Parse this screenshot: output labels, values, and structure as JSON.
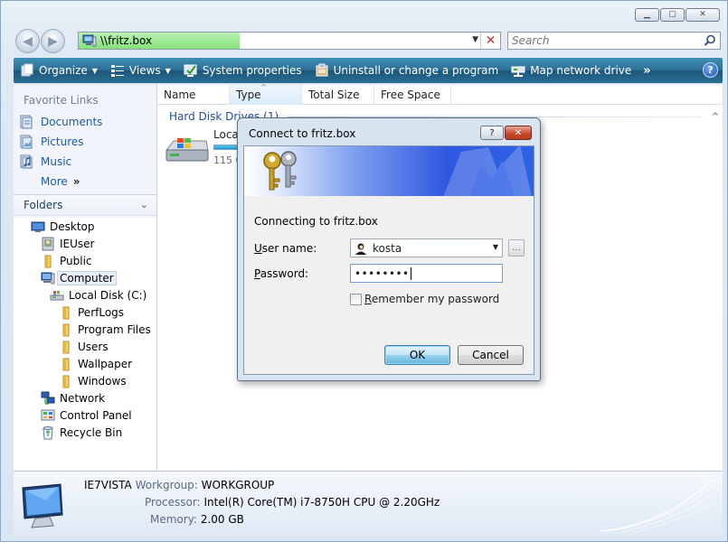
{
  "window": {
    "caption_buttons": [
      "minimize",
      "maximize",
      "close"
    ]
  },
  "address": {
    "path": "\\\\fritz.box"
  },
  "search": {
    "placeholder": "Search"
  },
  "toolbar": {
    "organize": "Organize",
    "views": "Views",
    "system_properties": "System properties",
    "uninstall": "Uninstall or change a program",
    "map_drive": "Map network drive",
    "more": "»",
    "help": "?"
  },
  "sidebar": {
    "favorite_links_title": "Favorite Links",
    "favorites": [
      {
        "label": "Documents",
        "icon": "documents-icon"
      },
      {
        "label": "Pictures",
        "icon": "pictures-icon"
      },
      {
        "label": "Music",
        "icon": "music-icon"
      }
    ],
    "more": "More",
    "more_chevron": "»",
    "folders_title": "Folders",
    "tree": [
      {
        "label": "Desktop",
        "icon": "desktop-icon"
      },
      {
        "label": "IEUser",
        "icon": "user-folder-icon"
      },
      {
        "label": "Public",
        "icon": "folder-icon"
      },
      {
        "label": "Computer",
        "icon": "computer-icon"
      },
      {
        "label": "Local Disk (C:)",
        "icon": "drive-icon"
      },
      {
        "label": "PerfLogs",
        "icon": "folder-icon"
      },
      {
        "label": "Program Files",
        "icon": "folder-icon"
      },
      {
        "label": "Users",
        "icon": "folder-icon"
      },
      {
        "label": "Wallpaper",
        "icon": "folder-icon"
      },
      {
        "label": "Windows",
        "icon": "folder-icon"
      },
      {
        "label": "Network",
        "icon": "network-icon"
      },
      {
        "label": "Control Panel",
        "icon": "control-panel-icon"
      },
      {
        "label": "Recycle Bin",
        "icon": "recycle-bin-icon"
      }
    ]
  },
  "content": {
    "columns": [
      "Name",
      "Type",
      "Total Size",
      "Free Space"
    ],
    "sorted_column": "Type",
    "group_header": "Hard Disk Drives (1)",
    "drive": {
      "name": "Local",
      "size_text": "115 G",
      "fill_fraction": 0.25
    }
  },
  "details": {
    "computer_name": "IE7VISTA",
    "workgroup_label": "Workgroup:",
    "workgroup": "WORKGROUP",
    "processor_label": "Processor:",
    "processor": "Intel(R) Core(TM) i7-8750H CPU @ 2.20GHz",
    "memory_label": "Memory:",
    "memory": "2.00 GB"
  },
  "dialog": {
    "title": "Connect to fritz.box",
    "help_button": "?",
    "close_button": "✕",
    "connecting_text": "Connecting to fritz.box",
    "username_label_pre": "",
    "username_label_key": "U",
    "username_label_post": "ser name:",
    "username_value": "kosta",
    "browse_label": "...",
    "password_label_pre": "",
    "password_label_key": "P",
    "password_label_post": "assword:",
    "password_value": "••••••••",
    "remember_label_pre": "",
    "remember_label_key": "R",
    "remember_label_post": "emember my password",
    "remember_checked": false,
    "ok": "OK",
    "cancel": "Cancel"
  },
  "colors": {
    "command_bar": "#2d6f96",
    "link_blue": "#1c5aa8",
    "group_header": "#1e4d9c",
    "address_progress": "#87e07b",
    "dialog_close": "#c7452a",
    "ok_button": "#98d1ef"
  }
}
